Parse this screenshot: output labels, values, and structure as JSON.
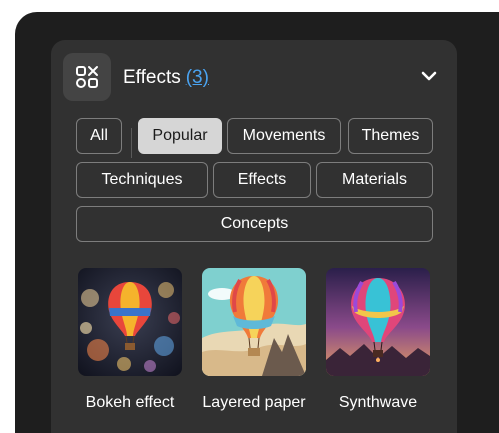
{
  "header": {
    "title": "Effects",
    "count": "(3)",
    "icon": "effects-grid-icon",
    "collapse_icon": "chevron-down-icon"
  },
  "filters": [
    {
      "label": "All",
      "selected": false
    },
    {
      "label": "Popular",
      "selected": true
    },
    {
      "label": "Movements",
      "selected": false
    },
    {
      "label": "Themes",
      "selected": false
    },
    {
      "label": "Techniques",
      "selected": false
    },
    {
      "label": "Effects",
      "selected": false
    },
    {
      "label": "Materials",
      "selected": false
    },
    {
      "label": "Concepts",
      "selected": false
    }
  ],
  "cards": [
    {
      "label": "Bokeh effect"
    },
    {
      "label": "Layered paper"
    },
    {
      "label": "Synthwave"
    }
  ],
  "colors": {
    "accent_link": "#4aa3f0",
    "panel": "#313131",
    "background": "#1e1e1e",
    "selected_chip": "#d6d6d6"
  }
}
